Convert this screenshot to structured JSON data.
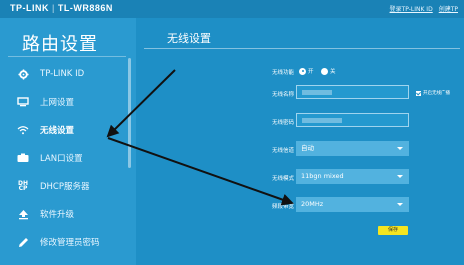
{
  "header": {
    "logo_brand": "TP-LINK",
    "logo_model": "TL-WR886N",
    "links": [
      "登录TP-LINK ID",
      "创建TP"
    ]
  },
  "sidebar": {
    "title": "路由设置",
    "items": [
      {
        "label": "TP-LINK ID",
        "icon": "gear-icon"
      },
      {
        "label": "上网设置",
        "icon": "monitor-icon"
      },
      {
        "label": "无线设置",
        "icon": "wifi-icon",
        "active": true
      },
      {
        "label": "LAN口设置",
        "icon": "lan-icon"
      },
      {
        "label": "DHCP服务器",
        "icon": "dhcp-icon"
      },
      {
        "label": "软件升级",
        "icon": "upload-icon"
      },
      {
        "label": "修改管理员密码",
        "icon": "pencil-icon"
      }
    ]
  },
  "main": {
    "title": "无线设置",
    "wireless_function": {
      "label": "无线功能",
      "on": "开",
      "off": "关",
      "selected": "on"
    },
    "ssid": {
      "label": "无线名称",
      "value": ""
    },
    "broadcast": {
      "label": "开启无线广播",
      "checked": true
    },
    "password": {
      "label": "无线密码",
      "value": ""
    },
    "channel": {
      "label": "无线信道",
      "value": "自动"
    },
    "mode": {
      "label": "无线模式",
      "value": "11bgn mixed"
    },
    "bandwidth": {
      "label": "频段带宽",
      "value": "20MHz"
    },
    "save_label": "保存"
  },
  "colors": {
    "background": "#1e8fc6",
    "sidebar": "#2a9ad0",
    "save_button": "#f5e51f"
  }
}
